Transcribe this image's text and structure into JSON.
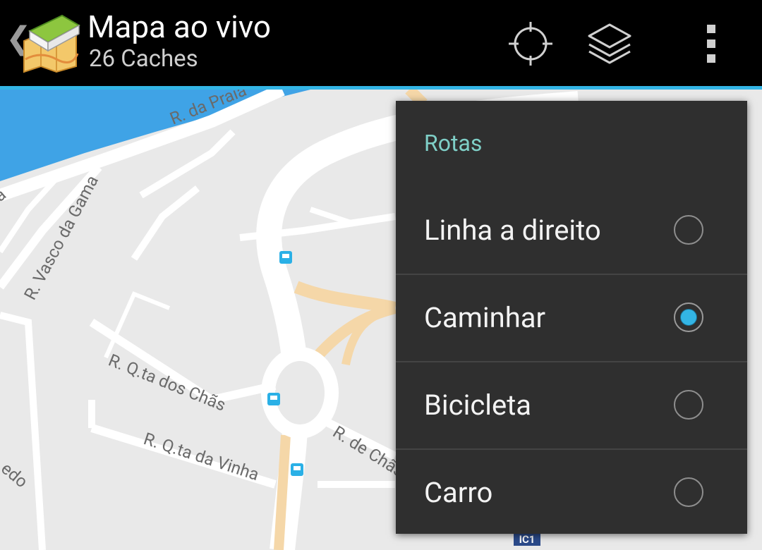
{
  "actionbar": {
    "title": "Mapa ao vivo",
    "subtitle": "26 Caches",
    "up_icon": "chevron-left-icon",
    "app_icon": "map-book-icon",
    "actions": [
      {
        "name": "my-location",
        "icon": "crosshair-icon"
      },
      {
        "name": "layers",
        "icon": "layers-icon"
      },
      {
        "name": "overflow",
        "icon": "overflow-menu-icon"
      }
    ],
    "accent_color": "#33b5e5"
  },
  "map": {
    "street_labels": [
      "R. da Praia",
      "R. Vasco da Gama",
      "R. Q.ta dos Chãs",
      "R. Q.ta da Vinha",
      "R. de Chãs",
      "edo",
      "a"
    ],
    "route_badge": "IC1",
    "colors": {
      "water": "#3fa3e6",
      "land": "#e9e9e9",
      "road": "#ffffff",
      "major_road": "#f5d7a8"
    }
  },
  "menu": {
    "title": "Rotas",
    "title_color": "#7fcfc7",
    "selected": "Caminhar",
    "items": [
      {
        "label": "Linha a direito",
        "checked": false
      },
      {
        "label": "Caminhar",
        "checked": true
      },
      {
        "label": "Bicicleta",
        "checked": false
      },
      {
        "label": "Carro",
        "checked": false
      }
    ]
  }
}
